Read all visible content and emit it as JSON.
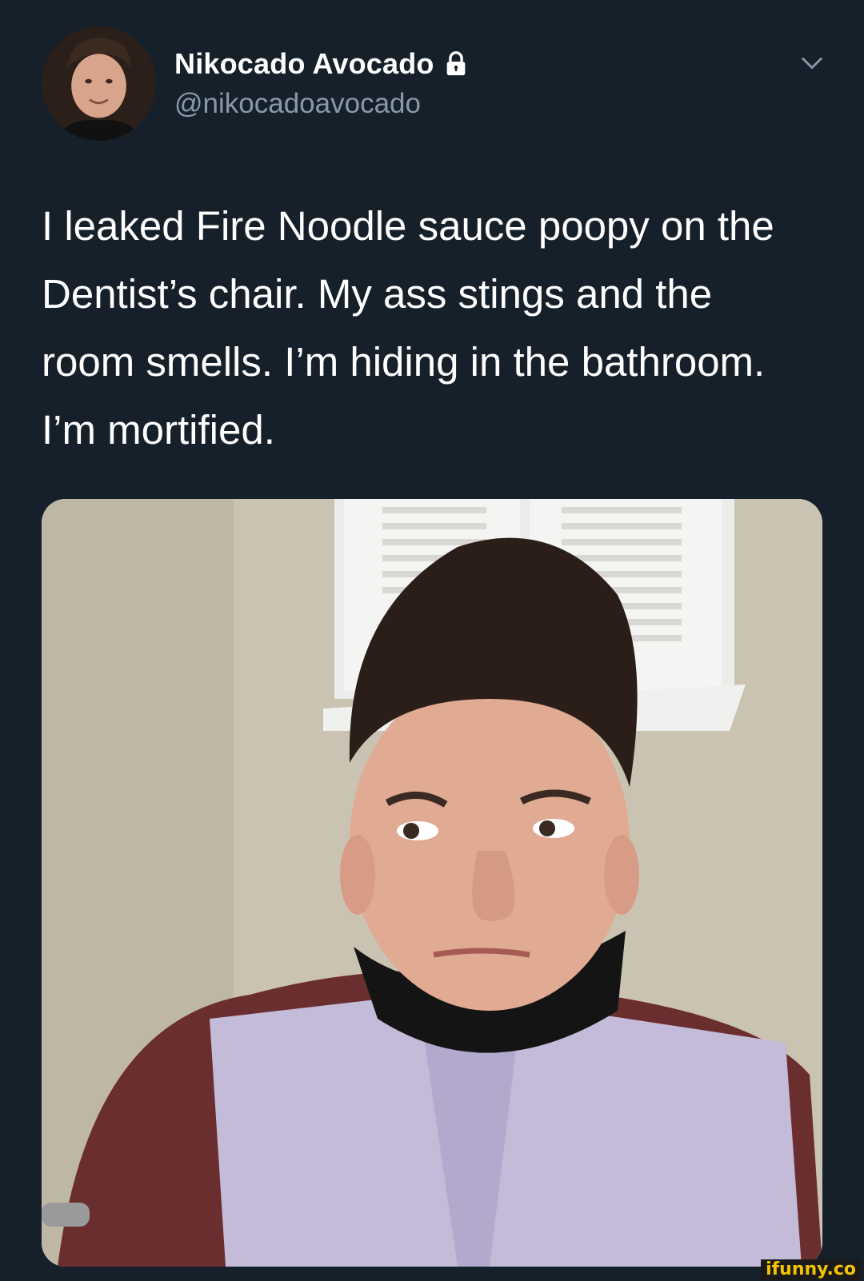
{
  "tweet": {
    "display_name": "Nikocado Avocado",
    "handle": "@nikocadoavocado",
    "protected_icon": "lock-icon",
    "menu_icon": "chevron-down-icon",
    "text": "I leaked Fire Noodle sauce poopy on the Dentist’s chair. My ass stings and the room smells. I’m hiding in the bathroom. I’m mortified."
  },
  "media": {
    "icon": "photo"
  },
  "watermark": {
    "text": "ifunny.co"
  },
  "colors": {
    "background": "#15202b",
    "primary_text": "#ffffff",
    "secondary_text": "#8899a6",
    "watermark_bg": "#1a1a1a",
    "watermark_text": "#f5c400"
  }
}
